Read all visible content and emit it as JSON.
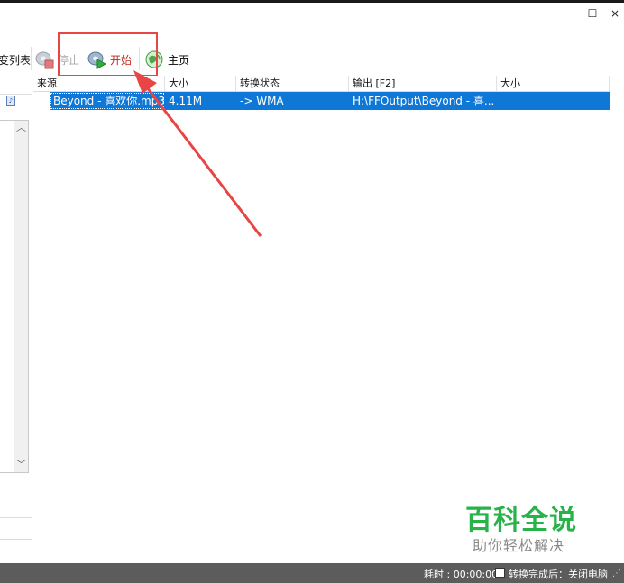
{
  "window": {
    "minimize_glyph": "–",
    "maximize_glyph": "☐",
    "close_glyph": "×"
  },
  "toolbar": {
    "left_label": "变列表",
    "stop_label": "停止",
    "start_label": "开始",
    "home_label": "主页",
    "stop_icon": "stop-icon",
    "start_icon": "start-icon",
    "home_icon": "home-icon"
  },
  "file_list": {
    "columns": [
      "来源",
      "大小",
      "转换状态",
      "输出 [F2]",
      "大小"
    ],
    "rows": [
      {
        "source": "Beyond - 喜欢你.mp3",
        "size": "4.11M",
        "status": "-> WMA",
        "output": "H:\\FFOutput\\Beyond - 喜...",
        "out_size": "",
        "icon": "audio-file-icon",
        "selected": true
      }
    ]
  },
  "watermark": {
    "title": "百科全说",
    "subtitle": "助你轻松解决"
  },
  "status_bar": {
    "elapsed": "耗时 : 00:00:00",
    "shutdown_label": "转换完成后：关闭电脑",
    "shutdown_checked": false
  },
  "colors": {
    "selection": "#0f78d7",
    "start_label": "#c2261c",
    "highlight": "#e84545",
    "watermark_green": "#27b34a",
    "status_bar": "#5c5c5c"
  }
}
